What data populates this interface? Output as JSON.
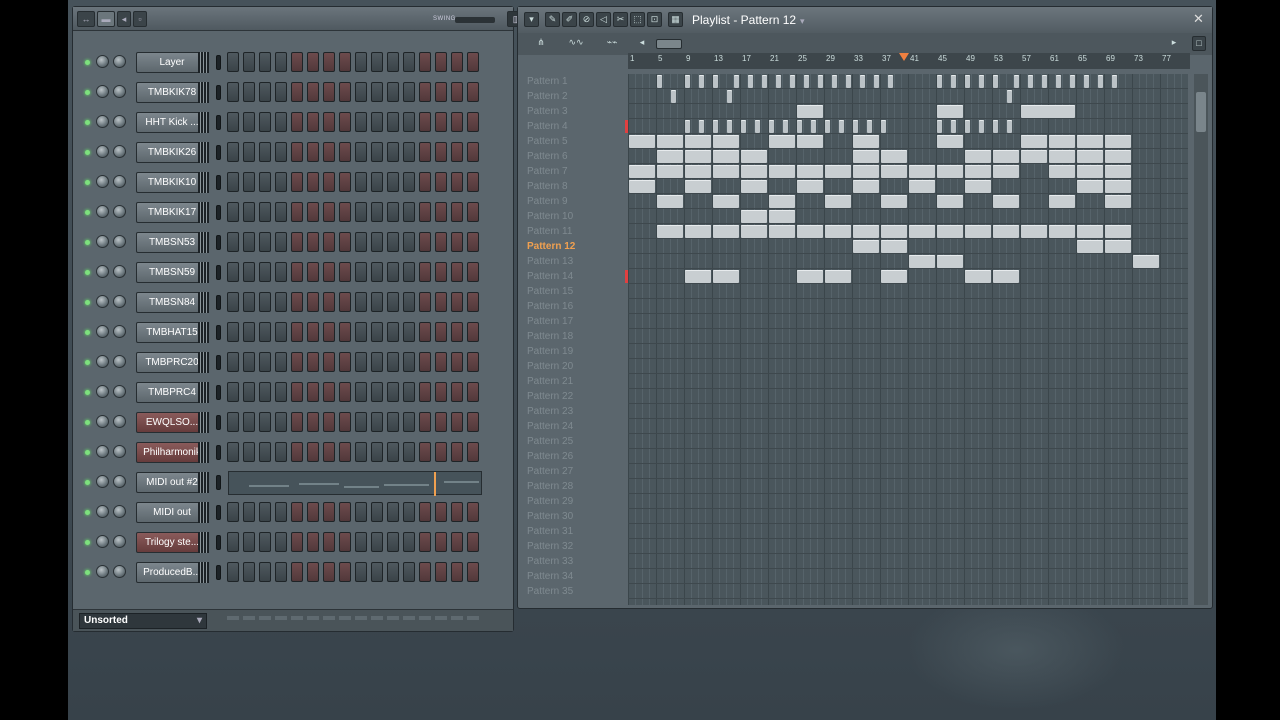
{
  "channel_rack": {
    "swing_label": "SWING",
    "category": "Unsorted",
    "channels": [
      {
        "name": "Layer",
        "color": "grey",
        "midi": false
      },
      {
        "name": "TMBKIK78",
        "color": "grey",
        "midi": false
      },
      {
        "name": "HHT Kick ...",
        "color": "grey",
        "midi": false
      },
      {
        "name": "TMBKIK26",
        "color": "grey",
        "midi": false
      },
      {
        "name": "TMBKIK10",
        "color": "grey",
        "midi": false
      },
      {
        "name": "TMBKIK17",
        "color": "grey",
        "midi": false
      },
      {
        "name": "TMBSN53",
        "color": "grey",
        "midi": false
      },
      {
        "name": "TMBSN59",
        "color": "grey",
        "midi": false
      },
      {
        "name": "TMBSN84",
        "color": "grey",
        "midi": false
      },
      {
        "name": "TMBHAT15",
        "color": "grey",
        "midi": false
      },
      {
        "name": "TMBPRC20",
        "color": "grey",
        "midi": false
      },
      {
        "name": "TMBPRC4",
        "color": "grey",
        "midi": false
      },
      {
        "name": "EWQLSO...",
        "color": "red",
        "midi": false
      },
      {
        "name": "Philharmonik",
        "color": "red",
        "midi": false
      },
      {
        "name": "MIDI out #2",
        "color": "grey",
        "midi": true
      },
      {
        "name": "MIDI out",
        "color": "grey",
        "midi": false
      },
      {
        "name": "Trilogy ste...",
        "color": "red",
        "midi": false
      },
      {
        "name": "ProducedB...",
        "color": "grey",
        "midi": false
      }
    ]
  },
  "playlist": {
    "title": "Playlist - Pattern 12",
    "ruler": [
      "1",
      "5",
      "9",
      "13",
      "17",
      "21",
      "25",
      "29",
      "33",
      "37",
      "41",
      "45",
      "49",
      "53",
      "57",
      "61",
      "65",
      "69",
      "73",
      "77"
    ],
    "selected": "Pattern 12",
    "patterns": [
      "Pattern 1",
      "Pattern 2",
      "Pattern 3",
      "Pattern 4",
      "Pattern 5",
      "Pattern 6",
      "Pattern 7",
      "Pattern 8",
      "Pattern 9",
      "Pattern 10",
      "Pattern 11",
      "Pattern 12",
      "Pattern 13",
      "Pattern 14",
      "Pattern 15",
      "Pattern 16",
      "Pattern 17",
      "Pattern 18",
      "Pattern 19",
      "Pattern 20",
      "Pattern 21",
      "Pattern 22",
      "Pattern 23",
      "Pattern 24",
      "Pattern 25",
      "Pattern 26",
      "Pattern 27",
      "Pattern 28",
      "Pattern 29",
      "Pattern 30",
      "Pattern 31",
      "Pattern 32",
      "Pattern 33",
      "Pattern 34",
      "Pattern 35"
    ],
    "clips": [
      {
        "row": 0,
        "bars": [
          [
            5,
            6
          ],
          [
            9,
            10
          ],
          [
            11,
            12
          ],
          [
            13,
            14
          ],
          [
            16,
            17
          ],
          [
            18,
            19
          ],
          [
            20,
            21
          ],
          [
            22,
            23
          ],
          [
            24,
            25
          ],
          [
            26,
            27
          ],
          [
            28,
            29
          ],
          [
            30,
            31
          ],
          [
            32,
            33
          ],
          [
            34,
            35
          ],
          [
            36,
            37
          ],
          [
            38,
            39
          ],
          [
            45,
            46
          ],
          [
            47,
            48
          ],
          [
            49,
            50
          ],
          [
            51,
            52
          ],
          [
            53,
            54
          ],
          [
            56,
            57
          ],
          [
            58,
            59
          ],
          [
            60,
            61
          ],
          [
            62,
            63
          ],
          [
            64,
            65
          ],
          [
            66,
            67
          ],
          [
            68,
            69
          ],
          [
            70,
            71
          ]
        ]
      },
      {
        "row": 1,
        "bars": [
          [
            7,
            8
          ],
          [
            15,
            16
          ],
          [
            55,
            56
          ]
        ]
      },
      {
        "row": 2,
        "bars": [
          [
            25,
            29
          ],
          [
            45,
            49
          ],
          [
            57,
            65
          ]
        ]
      },
      {
        "row": 3,
        "bars": [
          [
            9,
            10
          ],
          [
            11,
            12
          ],
          [
            13,
            14
          ],
          [
            15,
            16
          ],
          [
            17,
            18
          ],
          [
            19,
            20
          ],
          [
            21,
            22
          ],
          [
            23,
            24
          ],
          [
            25,
            26
          ],
          [
            27,
            28
          ],
          [
            29,
            30
          ],
          [
            31,
            32
          ],
          [
            33,
            34
          ],
          [
            35,
            36
          ],
          [
            37,
            38
          ],
          [
            45,
            46
          ],
          [
            47,
            48
          ],
          [
            49,
            50
          ],
          [
            51,
            52
          ],
          [
            53,
            54
          ],
          [
            55,
            56
          ]
        ]
      },
      {
        "row": 4,
        "bars": [
          [
            1,
            5
          ],
          [
            5,
            9
          ],
          [
            9,
            13
          ],
          [
            13,
            17
          ],
          [
            21,
            25
          ],
          [
            25,
            29
          ],
          [
            33,
            37
          ],
          [
            45,
            49
          ],
          [
            57,
            61
          ],
          [
            61,
            65
          ],
          [
            65,
            69
          ],
          [
            69,
            73
          ]
        ]
      },
      {
        "row": 5,
        "bars": [
          [
            5,
            9
          ],
          [
            9,
            13
          ],
          [
            13,
            17
          ],
          [
            17,
            21
          ],
          [
            33,
            37
          ],
          [
            37,
            41
          ],
          [
            49,
            53
          ],
          [
            53,
            57
          ],
          [
            57,
            61
          ],
          [
            61,
            65
          ],
          [
            65,
            69
          ],
          [
            69,
            73
          ]
        ]
      },
      {
        "row": 6,
        "bars": [
          [
            1,
            5
          ],
          [
            5,
            9
          ],
          [
            9,
            13
          ],
          [
            13,
            17
          ],
          [
            17,
            21
          ],
          [
            21,
            25
          ],
          [
            25,
            29
          ],
          [
            29,
            33
          ],
          [
            33,
            37
          ],
          [
            37,
            41
          ],
          [
            41,
            45
          ],
          [
            45,
            49
          ],
          [
            49,
            53
          ],
          [
            53,
            57
          ],
          [
            61,
            65
          ],
          [
            65,
            69
          ],
          [
            69,
            73
          ]
        ]
      },
      {
        "row": 7,
        "bars": [
          [
            1,
            5
          ],
          [
            9,
            13
          ],
          [
            17,
            21
          ],
          [
            25,
            29
          ],
          [
            33,
            37
          ],
          [
            41,
            45
          ],
          [
            49,
            53
          ],
          [
            65,
            69
          ],
          [
            69,
            73
          ]
        ]
      },
      {
        "row": 8,
        "bars": [
          [
            5,
            9
          ],
          [
            13,
            17
          ],
          [
            21,
            25
          ],
          [
            29,
            33
          ],
          [
            37,
            41
          ],
          [
            45,
            49
          ],
          [
            53,
            57
          ],
          [
            61,
            65
          ],
          [
            69,
            73
          ]
        ]
      },
      {
        "row": 9,
        "bars": [
          [
            17,
            21
          ],
          [
            21,
            25
          ]
        ]
      },
      {
        "row": 10,
        "bars": [
          [
            5,
            9
          ],
          [
            9,
            13
          ],
          [
            13,
            17
          ],
          [
            17,
            21
          ],
          [
            21,
            25
          ],
          [
            25,
            29
          ],
          [
            29,
            33
          ],
          [
            33,
            37
          ],
          [
            37,
            41
          ],
          [
            41,
            45
          ],
          [
            45,
            49
          ],
          [
            49,
            53
          ],
          [
            53,
            57
          ],
          [
            57,
            61
          ],
          [
            61,
            65
          ],
          [
            65,
            69
          ],
          [
            69,
            73
          ]
        ]
      },
      {
        "row": 11,
        "bars": [
          [
            33,
            37
          ],
          [
            37,
            41
          ],
          [
            65,
            69
          ],
          [
            69,
            73
          ]
        ]
      },
      {
        "row": 12,
        "bars": [
          [
            41,
            45
          ],
          [
            45,
            49
          ],
          [
            73,
            77
          ]
        ]
      },
      {
        "row": 13,
        "bars": [
          [
            9,
            13
          ],
          [
            13,
            17
          ],
          [
            25,
            29
          ],
          [
            29,
            33
          ],
          [
            37,
            41
          ],
          [
            49,
            53
          ],
          [
            53,
            57
          ]
        ]
      }
    ]
  }
}
